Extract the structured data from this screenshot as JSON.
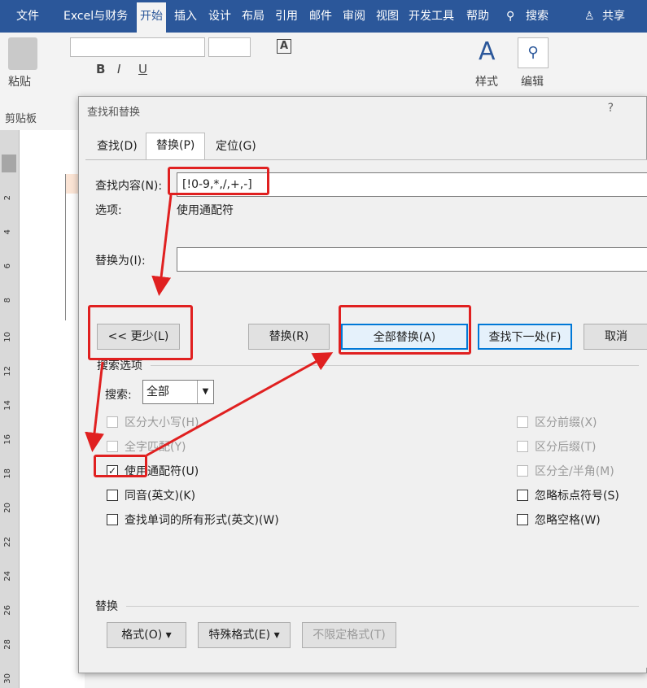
{
  "ribbon_tabs": [
    "文件",
    "Excel与财务",
    "开始",
    "插入",
    "设计",
    "布局",
    "引用",
    "邮件",
    "审阅",
    "视图",
    "开发工具",
    "帮助"
  ],
  "search_label": "搜索",
  "share_label": "共享",
  "ribbon": {
    "paste_label": "粘贴",
    "clipboard_label": "剪贴板",
    "styles_label": "样式",
    "edit_label": "编辑",
    "ruler_num": "2"
  },
  "ruler_numbers": [
    "2",
    "4",
    "6",
    "8",
    "10",
    "12",
    "14",
    "16",
    "18",
    "20",
    "22",
    "24",
    "26",
    "28",
    "30"
  ],
  "dialog": {
    "title": "查找和替换",
    "help": "?",
    "tabs": [
      "查找(D)",
      "替换(P)",
      "定位(G)"
    ],
    "find_label": "查找内容(N):",
    "find_value": "[!0-9,*,/,+,-]",
    "options_label": "选项:",
    "options_value": "使用通配符",
    "replace_label": "替换为(I):",
    "replace_value": "",
    "buttons": {
      "less": "<< 更少(L)",
      "replace": "替换(R)",
      "replace_all": "全部替换(A)",
      "find_next": "查找下一处(F)",
      "cancel": "取消"
    },
    "search_options_label": "搜索选项",
    "search_label": "搜索:",
    "search_value": "全部",
    "left_options": [
      {
        "label": "区分大小写(H)",
        "checked": false,
        "disabled": true
      },
      {
        "label": "全字匹配(Y)",
        "checked": false,
        "disabled": true
      },
      {
        "label": "使用通配符(U)",
        "checked": true,
        "disabled": false
      },
      {
        "label": "同音(英文)(K)",
        "checked": false,
        "disabled": false
      },
      {
        "label": "查找单词的所有形式(英文)(W)",
        "checked": false,
        "disabled": false
      }
    ],
    "right_options": [
      {
        "label": "区分前缀(X)",
        "checked": false,
        "disabled": true
      },
      {
        "label": "区分后缀(T)",
        "checked": false,
        "disabled": true
      },
      {
        "label": "区分全/半角(M)",
        "checked": false,
        "disabled": true
      },
      {
        "label": "忽略标点符号(S)",
        "checked": false,
        "disabled": false
      },
      {
        "label": "忽略空格(W)",
        "checked": false,
        "disabled": false
      }
    ],
    "replace_section_label": "替换",
    "bottom_buttons": {
      "format": "格式(O) ▾",
      "special": "特殊格式(E) ▾",
      "no_format": "不限定格式(T)"
    }
  },
  "colors": {
    "accent": "#2b579a",
    "highlight": "#e02020",
    "focus": "#0078d7"
  }
}
